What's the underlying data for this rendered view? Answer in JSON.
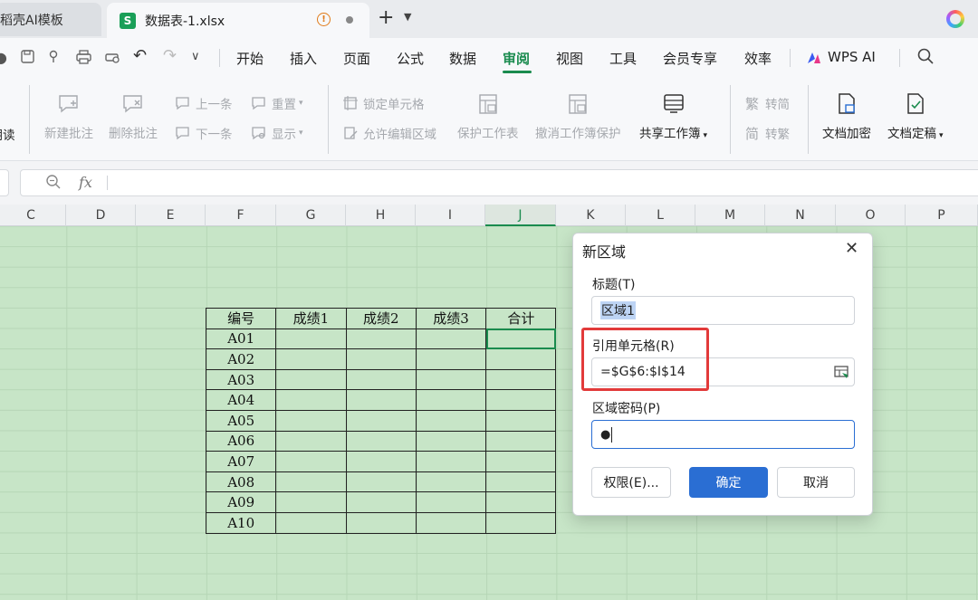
{
  "titlebar": {
    "tab_template": "稻壳AI模板",
    "tab_active": "数据表-1.xlsx",
    "new_tab": "+"
  },
  "menu": {
    "items": [
      "开始",
      "插入",
      "页面",
      "公式",
      "数据",
      "审阅",
      "视图",
      "工具",
      "会员专享",
      "效率"
    ],
    "active": "审阅",
    "wps_ai": "WPS AI"
  },
  "ribbon": {
    "read": "朗读",
    "new_comment": "新建批注",
    "delete_comment": "删除批注",
    "prev": "上一条",
    "next": "下一条",
    "reset": "重置",
    "show": "显示",
    "lock_cell": "锁定单元格",
    "allow_edit": "允许编辑区域",
    "protect_sheet": "保护工作表",
    "unprotect_book": "撤消工作簿保护",
    "share_book": "共享工作簿",
    "to_simplified": "转简",
    "to_traditional": "转繁",
    "encrypt": "文档加密",
    "finalize": "文档定稿"
  },
  "formula": {
    "fx": "fx",
    "value": ""
  },
  "columns": [
    "C",
    "D",
    "E",
    "F",
    "G",
    "H",
    "I",
    "J",
    "K",
    "L",
    "M",
    "N",
    "O",
    "P"
  ],
  "selected_column": "J",
  "table": {
    "headers": [
      "编号",
      "成绩1",
      "成绩2",
      "成绩3",
      "合计"
    ],
    "rows": [
      "A01",
      "A02",
      "A03",
      "A04",
      "A05",
      "A06",
      "A07",
      "A08",
      "A09",
      "A10"
    ]
  },
  "dialog": {
    "title": "新区域",
    "title_label": "标题(T)",
    "title_value": "区域1",
    "ref_label": "引用单元格(R)",
    "ref_value": "=$G$6:$I$14",
    "password_label": "区域密码(P)",
    "password_value": "●",
    "permissions_button": "权限(E)...",
    "ok_button": "确定",
    "cancel_button": "取消"
  },
  "colors": {
    "accent": "#1a8b4e",
    "primary_button": "#2a6ed3",
    "highlight": "#e23a3a",
    "grid_bg": "#c7e5c7"
  }
}
